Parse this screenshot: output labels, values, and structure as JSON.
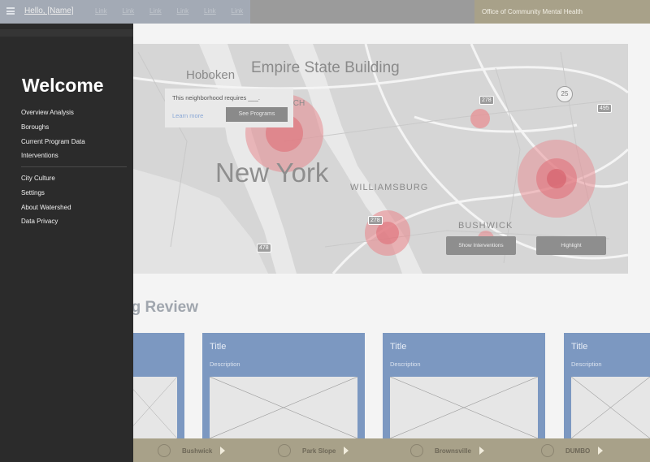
{
  "topbar": {
    "greeting": "Hello, [Name]",
    "nav_links": [
      "Link",
      "Link",
      "Link",
      "Link",
      "Link",
      "Link"
    ],
    "org_name": "Office of Community Mental Health"
  },
  "sidebar": {
    "welcome": "Welcome",
    "group1": [
      "Overview Analysis",
      "Boroughs",
      "Current Program Data",
      "Interventions"
    ],
    "group2": [
      "City Culture",
      "Settings",
      "About Watershed",
      "Data Privacy"
    ]
  },
  "map": {
    "labels": {
      "empire_state": "Empire State Building",
      "hoboken": "Hoboken",
      "new_york": "New York",
      "williamsburg": "WILLIAMSBURG",
      "bushwick": "BUSHWICK",
      "ich": "ICH"
    },
    "route_shields": [
      "278",
      "25",
      "495",
      "278",
      "478"
    ],
    "tooltip": {
      "text": "This neighborhood requires ___.",
      "link": "Learn more",
      "button": "See Programs"
    },
    "buttons": {
      "show_interventions": "Show Interventions",
      "highlight": "Highlight"
    }
  },
  "review": {
    "title": "ng Review",
    "cards": [
      {
        "title": "",
        "description": ""
      },
      {
        "title": "Title",
        "description": "Description"
      },
      {
        "title": "Title",
        "description": "Description"
      },
      {
        "title": "Title",
        "description": "Description"
      }
    ]
  },
  "bottombar": {
    "neighborhoods": [
      "Bushwick",
      "Park Slope",
      "Brownsville",
      "DUMBO"
    ]
  },
  "colors": {
    "sidebar_bg": "#2b2b2b",
    "card_blue": "#7c98c1",
    "bottombar_tan": "#a8a189",
    "bubble_red": "#e88a8f"
  }
}
